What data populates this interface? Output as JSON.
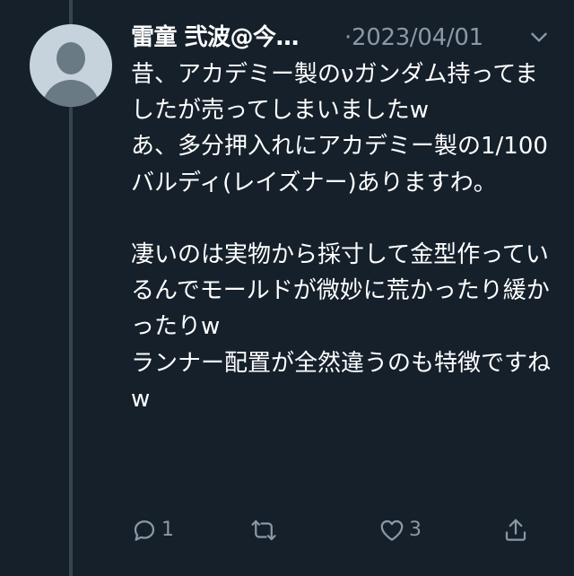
{
  "tweet": {
    "display_name": "雷童 弐波@今…",
    "date": "·2023/04/01",
    "text": "昔、アカデミー製のνガンダム持ってましたが売ってしまいましたw\nあ、多分押入れにアカデミー製の1/100 バルディ(レイズナー)ありますわ。\n\n凄いのは実物から採寸して金型作っているんでモールドが微妙に荒かったり緩かったりw\nランナー配置が全然違うのも特徴ですねw"
  },
  "actions": {
    "reply": {
      "icon": "reply-icon",
      "count": "1"
    },
    "retweet": {
      "icon": "retweet-icon",
      "count": ""
    },
    "like": {
      "icon": "heart-icon",
      "count": "3"
    },
    "share": {
      "icon": "share-icon"
    }
  },
  "colors": {
    "background": "#15202b",
    "text": "#ffffff",
    "secondary": "#8b98a5",
    "thread_line": "#38444d",
    "avatar_bg": "#c6d3dc",
    "avatar_fg": "#6a7a85"
  }
}
